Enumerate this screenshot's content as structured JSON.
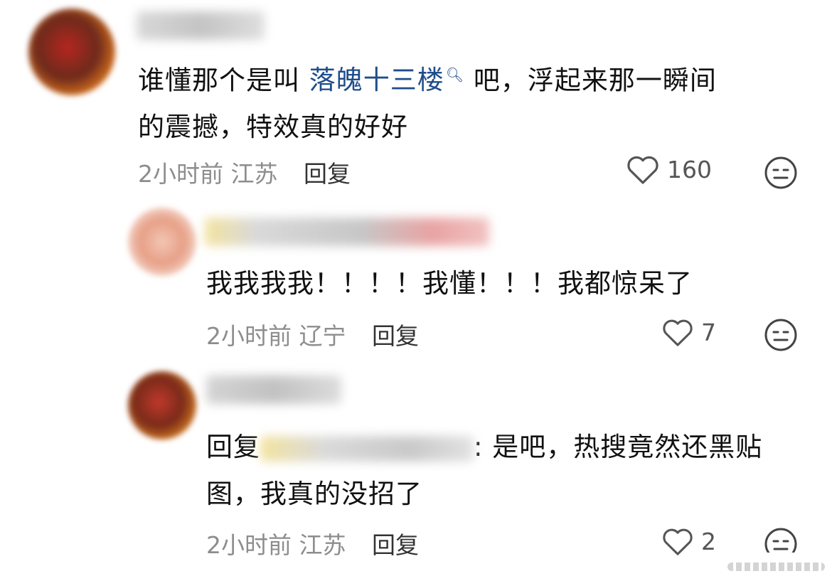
{
  "comments": [
    {
      "text_before_link": "谁懂那个是叫 ",
      "link_text": "落魄十三楼",
      "text_after_link": " 吧，浮起来那一瞬间",
      "text_line2": "的震撼，特效真的好好",
      "time": "2小时前",
      "location": "江苏",
      "reply_label": "回复",
      "like_count": "160",
      "colors": {
        "avatar": "#c0392b"
      }
    },
    {
      "text": "我我我我！！！！我懂！！！我都惊呆了",
      "time": "2小时前",
      "location": "辽宁",
      "reply_label": "回复",
      "like_count": "7"
    },
    {
      "reply_prefix": "回复",
      "text_after": ": 是吧，热搜竟然还黑贴",
      "text_line2": "图，我真的没招了",
      "time": "2小时前",
      "location": "江苏",
      "reply_label": "回复",
      "like_count": "2"
    }
  ],
  "icons": {
    "like": "heart-outline-icon",
    "reaction": "neutral-face-icon",
    "search": "search-icon"
  }
}
